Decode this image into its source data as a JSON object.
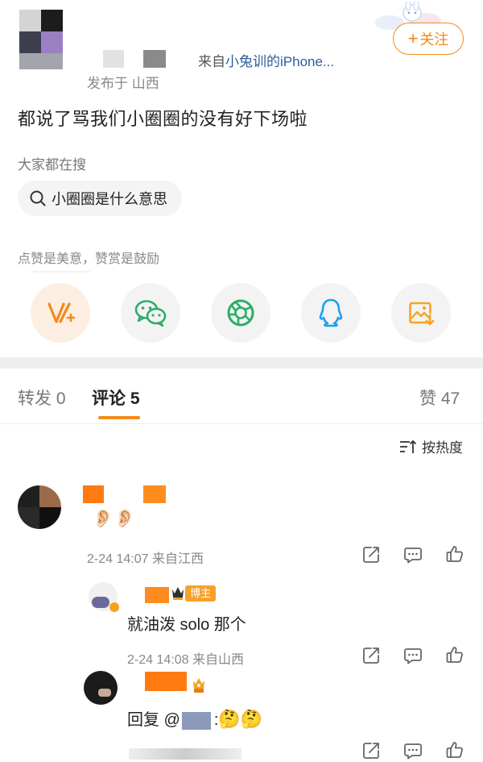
{
  "header": {
    "source_prefix": "来自",
    "source_app": "小兔训的iPhone...",
    "publish_location": "发布于 山西",
    "follow_label": "关注",
    "follow_plus": "+"
  },
  "post": {
    "text": "都说了骂我们小圈圈的没有好下场啦"
  },
  "search": {
    "title": "大家都在搜",
    "query": "小圈圈是什么意思"
  },
  "like_hint": "点赞是美意，赞赏是鼓励",
  "share_icons": [
    "reward-v-icon",
    "wechat-icon",
    "moments-icon",
    "qq-icon",
    "save-image-icon"
  ],
  "tabs": {
    "repost": "转发 0",
    "comment": "评论 5",
    "like": "赞 47"
  },
  "sort_label": "按热度",
  "comments": [
    {
      "content": "👂🏻👂🏻",
      "meta": "2-24 14:07 来自江西"
    }
  ],
  "replies": [
    {
      "badge": "博主",
      "text": "就油泼 solo 那个",
      "meta": "2-24 14:08 来自山西"
    },
    {
      "prefix": "回复 @",
      "suffix": ":",
      "emojis": "🤔🤔"
    }
  ],
  "colors": {
    "accent": "#f28a1a",
    "wechat": "#2aae67",
    "qq": "#1ea0f0",
    "save": "#f5a623"
  }
}
